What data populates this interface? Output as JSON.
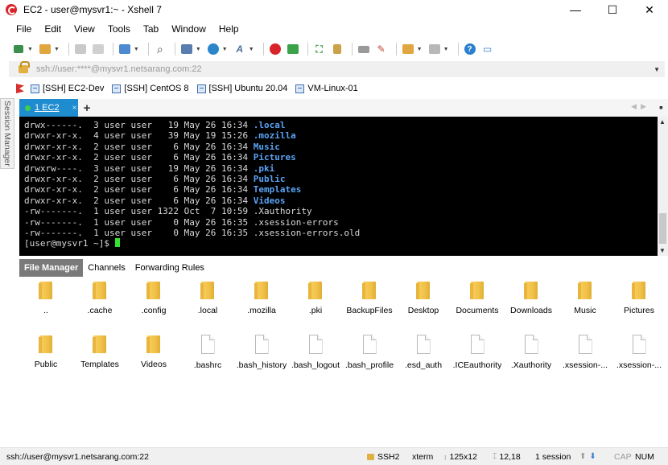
{
  "window": {
    "title": "EC2 - user@mysvr1:~ - Xshell 7"
  },
  "window_controls": {
    "minimize": "—",
    "maximize": "☐",
    "close": "✕"
  },
  "menu": [
    "File",
    "Edit",
    "View",
    "Tools",
    "Tab",
    "Window",
    "Help"
  ],
  "address": {
    "value": "ssh://user:****@mysvr1.netsarang.com:22"
  },
  "links": [
    "[SSH] EC2-Dev",
    "[SSH] CentOS 8",
    "[SSH] Ubuntu 20.04",
    "VM-Linux-01"
  ],
  "session_manager": {
    "label": "Session Manager"
  },
  "tabs": {
    "active_label": "1 EC2",
    "close": "×",
    "add": "+"
  },
  "terminal": {
    "lines": [
      {
        "text": "drwx------.  3 user user   19 May 26 16:34 ",
        "name": ".local",
        "dir": true
      },
      {
        "text": "drwxr-xr-x.  4 user user   39 May 19 15:26 ",
        "name": ".mozilla",
        "dir": true
      },
      {
        "text": "drwxr-xr-x.  2 user user    6 May 26 16:34 ",
        "name": "Music",
        "dir": true
      },
      {
        "text": "drwxr-xr-x.  2 user user    6 May 26 16:34 ",
        "name": "Pictures",
        "dir": true
      },
      {
        "text": "drwxrw----.  3 user user   19 May 26 16:34 ",
        "name": ".pki",
        "dir": true
      },
      {
        "text": "drwxr-xr-x.  2 user user    6 May 26 16:34 ",
        "name": "Public",
        "dir": true
      },
      {
        "text": "drwxr-xr-x.  2 user user    6 May 26 16:34 ",
        "name": "Templates",
        "dir": true
      },
      {
        "text": "drwxr-xr-x.  2 user user    6 May 26 16:34 ",
        "name": "Videos",
        "dir": true
      },
      {
        "text": "-rw-------.  1 user user 1322 Oct  7 10:59 ",
        "name": ".Xauthority",
        "dir": false
      },
      {
        "text": "-rw-------.  1 user user    0 May 26 16:35 ",
        "name": ".xsession-errors",
        "dir": false
      },
      {
        "text": "-rw-------.  1 user user    0 May 26 16:35 ",
        "name": ".xsession-errors.old",
        "dir": false
      }
    ],
    "prompt": "[user@mysvr1 ~]$ "
  },
  "file_manager": {
    "tabs": [
      "File Manager",
      "Channels",
      "Forwarding Rules"
    ],
    "items": [
      {
        "name": "..",
        "type": "folder"
      },
      {
        "name": ".cache",
        "type": "folder"
      },
      {
        "name": ".config",
        "type": "folder"
      },
      {
        "name": ".local",
        "type": "folder"
      },
      {
        "name": ".mozilla",
        "type": "folder"
      },
      {
        "name": ".pki",
        "type": "folder"
      },
      {
        "name": "BackupFiles",
        "type": "folder"
      },
      {
        "name": "Desktop",
        "type": "folder"
      },
      {
        "name": "Documents",
        "type": "folder"
      },
      {
        "name": "Downloads",
        "type": "folder"
      },
      {
        "name": "Music",
        "type": "folder"
      },
      {
        "name": "Pictures",
        "type": "folder"
      },
      {
        "name": "Public",
        "type": "folder"
      },
      {
        "name": "Templates",
        "type": "folder"
      },
      {
        "name": "Videos",
        "type": "folder"
      },
      {
        "name": ".bashrc",
        "type": "file"
      },
      {
        "name": ".bash_history",
        "type": "file"
      },
      {
        "name": ".bash_logout",
        "type": "file"
      },
      {
        "name": ".bash_profile",
        "type": "file"
      },
      {
        "name": ".esd_auth",
        "type": "file"
      },
      {
        "name": ".ICEauthority",
        "type": "file"
      },
      {
        "name": ".Xauthority",
        "type": "file"
      },
      {
        "name": ".xsession-...",
        "type": "file"
      },
      {
        "name": ".xsession-...",
        "type": "file"
      }
    ]
  },
  "status": {
    "connection": "ssh://user@mysvr1.netsarang.com:22",
    "protocol": "SSH2",
    "terminal_type": "xterm",
    "size": "125x12",
    "cursor": "12,18",
    "sessions": "1 session",
    "caps": "CAP",
    "num": "NUM"
  },
  "colors": {
    "tab_active": "#1e8ccf",
    "terminal_bg": "#000000",
    "dir_text": "#5aa3f5",
    "cursor": "#32e232"
  }
}
